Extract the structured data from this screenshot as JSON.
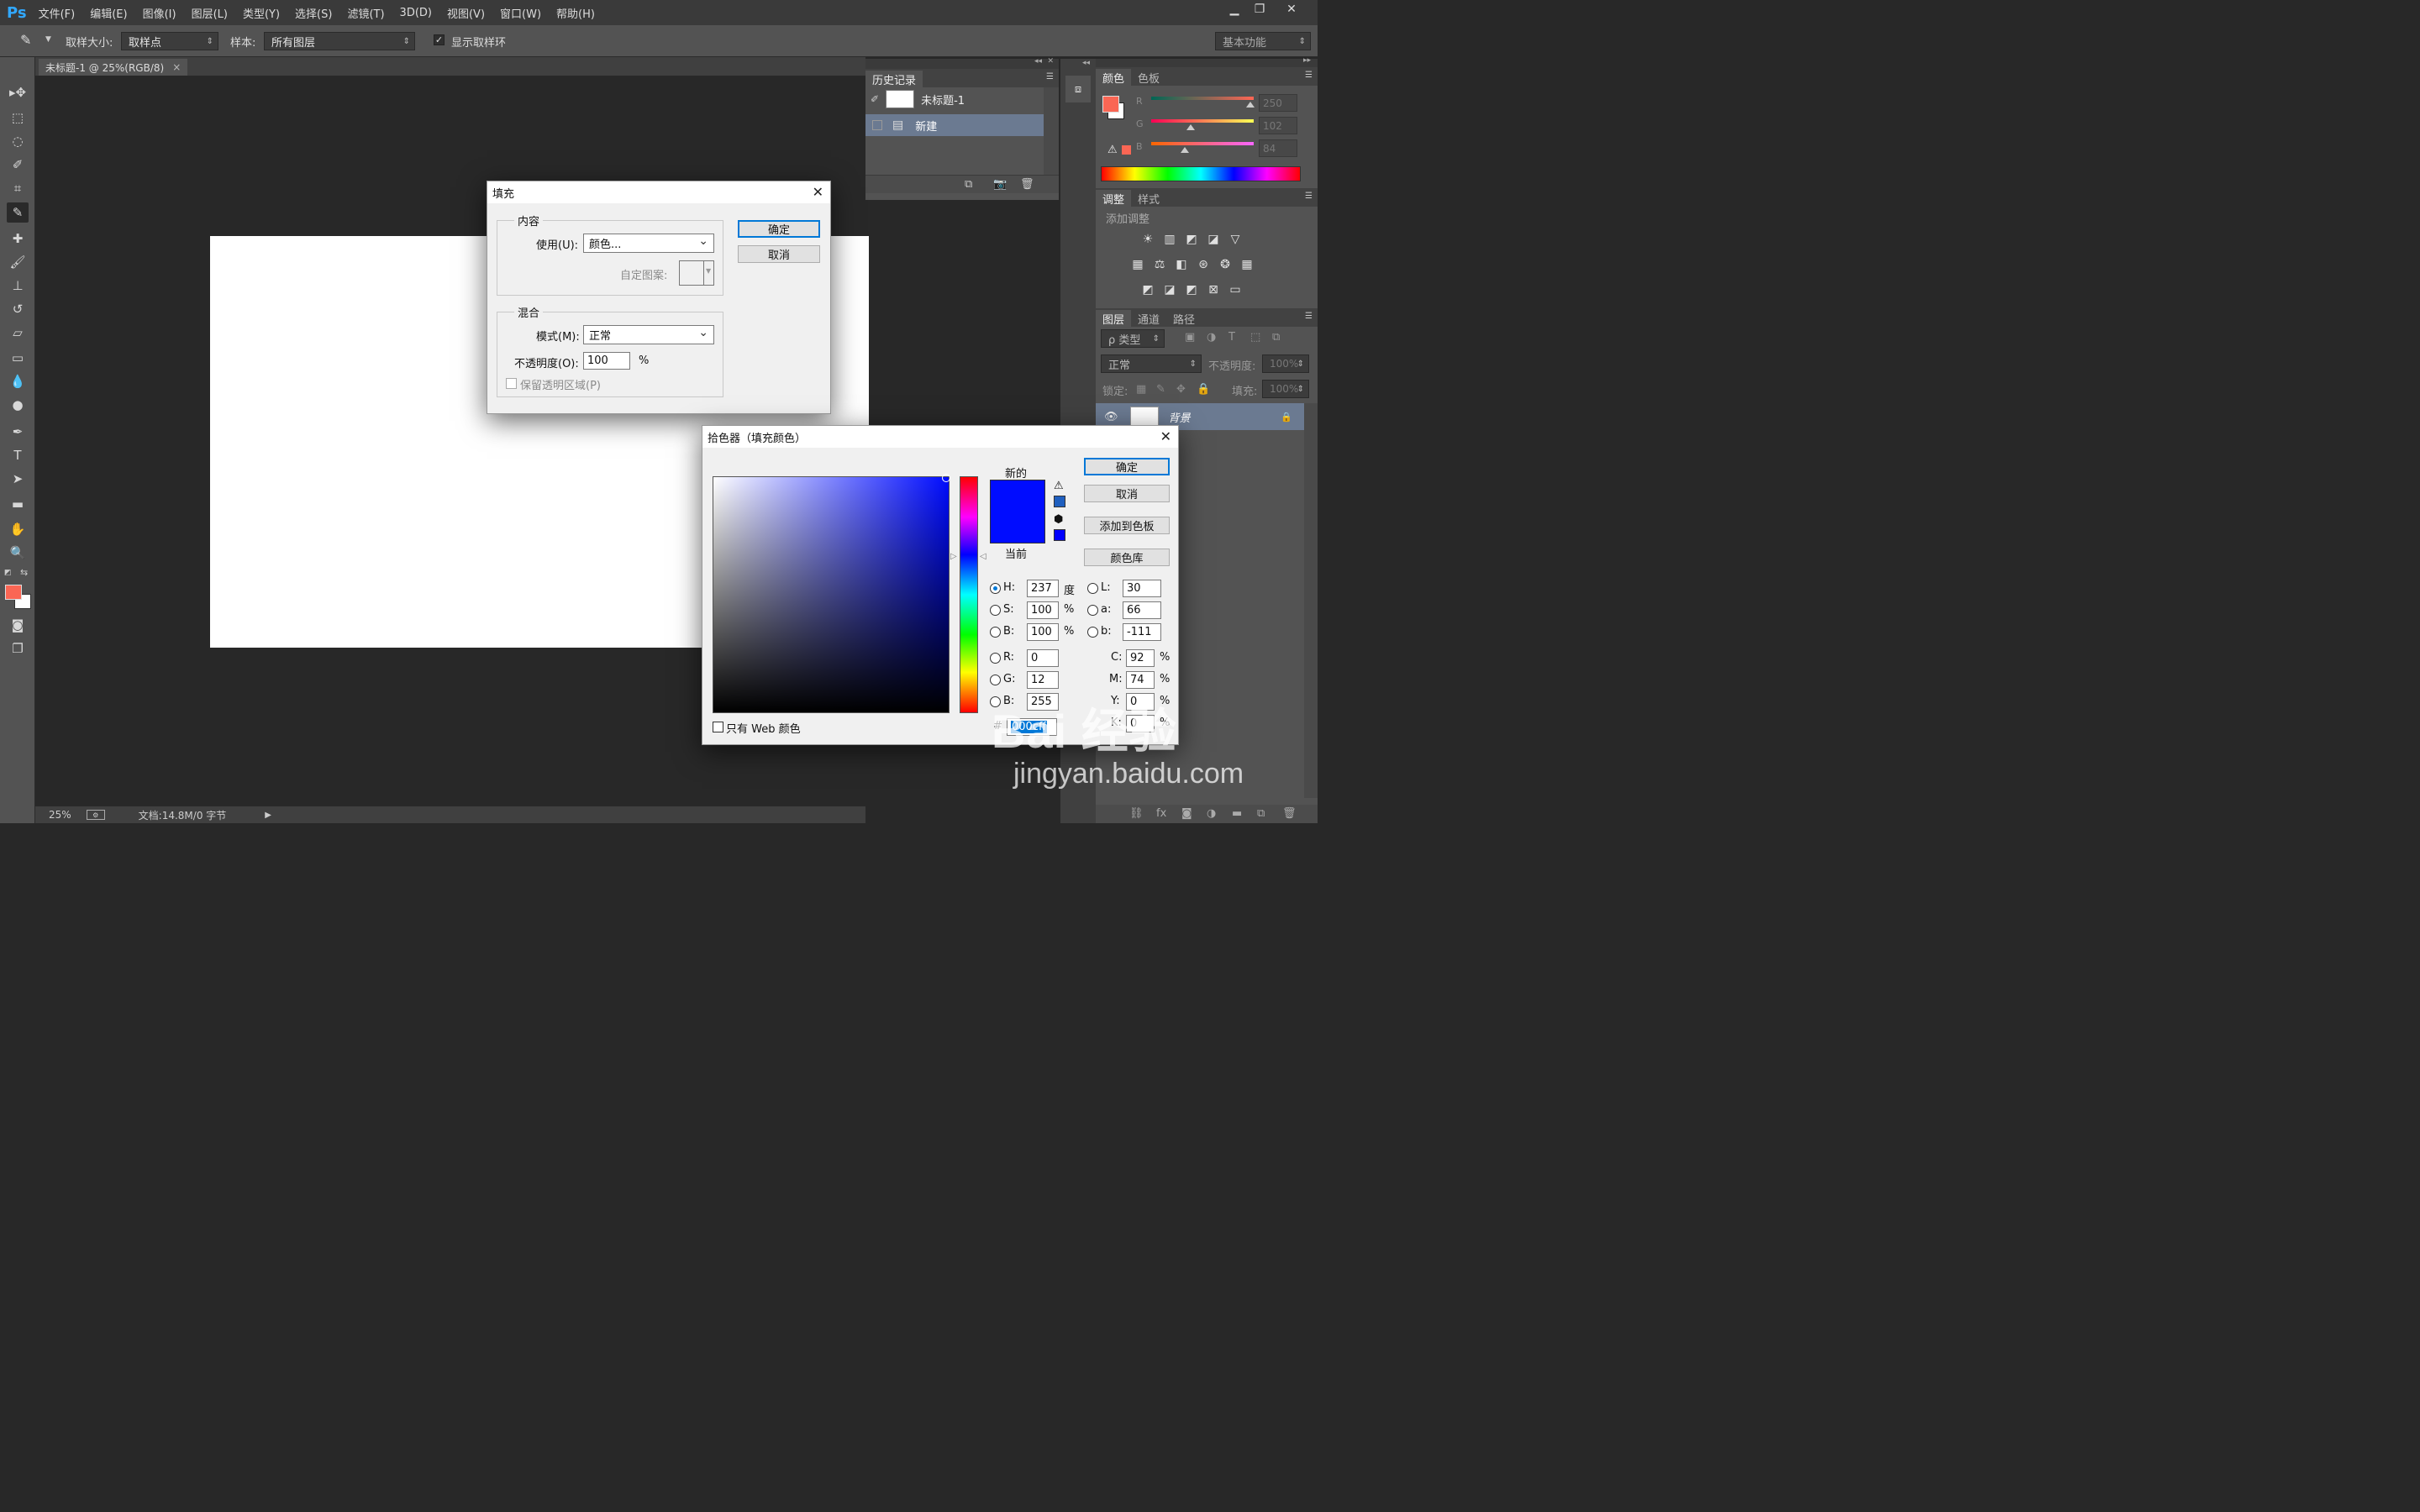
{
  "app": {
    "logo": "Ps"
  },
  "menu": [
    "文件(F)",
    "编辑(E)",
    "图像(I)",
    "图层(L)",
    "类型(Y)",
    "选择(S)",
    "滤镜(T)",
    "3D(D)",
    "视图(V)",
    "窗口(W)",
    "帮助(H)"
  ],
  "window_controls": {
    "minimize": "▁",
    "restore": "❐",
    "close": "✕"
  },
  "options": {
    "sample_size_label": "取样大小:",
    "sample_size_value": "取样点",
    "sample_label": "样本:",
    "sample_value": "所有图层",
    "show_ring_label": "显示取样环",
    "workspace": "基本功能"
  },
  "document": {
    "tab_title": "未标题-1 @ 25%(RGB/8)",
    "tab_close": "×",
    "canvas_color": "#ffffff"
  },
  "status": {
    "zoom": "25%",
    "doc_info": "文档:14.8M/0 字节"
  },
  "history_panel": {
    "tab": "历史记录",
    "snapshot_name": "未标题-1",
    "steps": [
      "新建"
    ]
  },
  "color_panel": {
    "tabs": [
      "颜色",
      "色板"
    ],
    "channels": [
      {
        "label": "R",
        "value": "250"
      },
      {
        "label": "G",
        "value": "102"
      },
      {
        "label": "B",
        "value": "84"
      }
    ],
    "foreground": "#fa6654",
    "background": "#ffffff"
  },
  "adjust_panel": {
    "tabs": [
      "调整",
      "样式"
    ],
    "add_label": "添加调整"
  },
  "layers_panel": {
    "tabs": [
      "图层",
      "通道",
      "路径"
    ],
    "filter_label": "ρ 类型",
    "blend_mode": "正常",
    "opacity_label": "不透明度:",
    "opacity_value": "100%",
    "lock_label": "锁定:",
    "fill_label": "填充:",
    "fill_value": "100%",
    "layer_name": "背景"
  },
  "fill_dialog": {
    "title": "填充",
    "content_group": "内容",
    "use_label": "使用(U):",
    "use_value": "颜色...",
    "pattern_label": "自定图案:",
    "blend_group": "混合",
    "mode_label": "模式(M):",
    "mode_value": "正常",
    "opacity_label": "不透明度(O):",
    "opacity_value": "100",
    "opacity_unit": "%",
    "preserve_label": "保留透明区域(P)",
    "ok": "确定",
    "cancel": "取消",
    "close": "✕"
  },
  "color_picker": {
    "title": "拾色器（填充颜色）",
    "close": "✕",
    "new_label": "新的",
    "current_label": "当前",
    "new_color": "#000cff",
    "current_color": "#000cff",
    "ok": "确定",
    "cancel": "取消",
    "add_swatch": "添加到色板",
    "libraries": "颜色库",
    "web_only": "只有 Web 颜色",
    "hsb": [
      {
        "label": "H:",
        "value": "237",
        "unit": "度"
      },
      {
        "label": "S:",
        "value": "100",
        "unit": "%"
      },
      {
        "label": "B:",
        "value": "100",
        "unit": "%"
      }
    ],
    "rgb": [
      {
        "label": "R:",
        "value": "0"
      },
      {
        "label": "G:",
        "value": "12"
      },
      {
        "label": "B:",
        "value": "255"
      }
    ],
    "lab": [
      {
        "label": "L:",
        "value": "30"
      },
      {
        "label": "a:",
        "value": "66"
      },
      {
        "label": "b:",
        "value": "-111"
      }
    ],
    "cmyk": [
      {
        "label": "C:",
        "value": "92",
        "unit": "%"
      },
      {
        "label": "M:",
        "value": "74",
        "unit": "%"
      },
      {
        "label": "Y:",
        "value": "0",
        "unit": "%"
      },
      {
        "label": "K:",
        "value": "0",
        "unit": "%"
      }
    ],
    "hex_label": "#",
    "hex_value": "000cff"
  },
  "watermark": {
    "brand": "Bai 经验",
    "url": "jingyan.baidu.com"
  }
}
